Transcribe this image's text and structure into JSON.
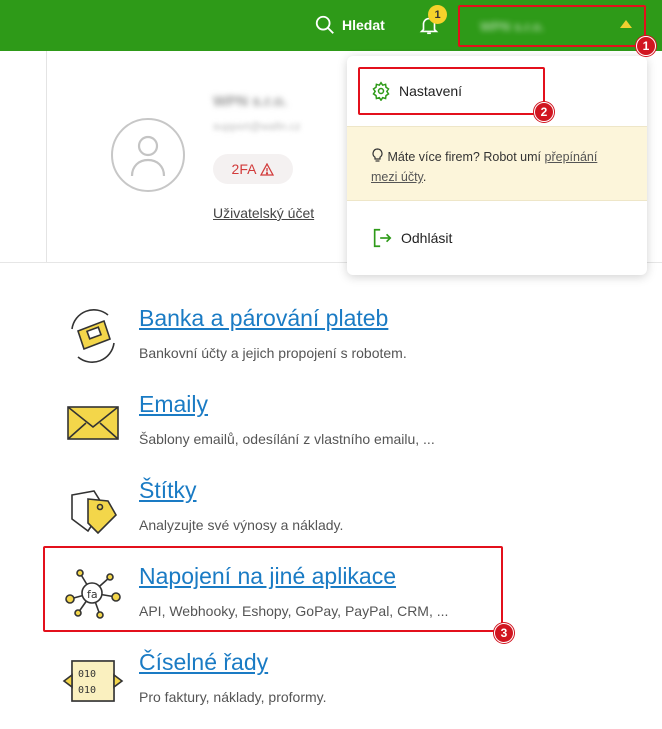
{
  "topbar": {
    "search_label": "Hledat",
    "notification_count": "1",
    "company_name": "WPN s.r.o."
  },
  "user": {
    "name": "WPN s.r.o.",
    "email": "support@wafin.cz",
    "twofa_label": "2FA",
    "account_link": "Uživatelský účet"
  },
  "dropdown": {
    "settings_label": "Nastavení",
    "tip_text": "Máte více firem? Robot umí ",
    "tip_link": "přepínání mezi účty",
    "tip_end": ".",
    "logout_label": "Odhlásit"
  },
  "items": [
    {
      "title": "Banka a párování plateb",
      "desc": "Bankovní účty a jejich propojení s robotem.",
      "icon": "bank-sync-icon"
    },
    {
      "title": "Emaily",
      "desc": "Šablony emailů, odesílání z vlastního emailu, ...",
      "icon": "envelope-icon"
    },
    {
      "title": "Štítky",
      "desc": "Analyzujte své výnosy a náklady.",
      "icon": "tag-icon"
    },
    {
      "title": "Napojení na jiné aplikace",
      "desc": "API, Webhooky, Eshopy, GoPay, PayPal, CRM, ...",
      "icon": "integrations-icon"
    },
    {
      "title": "Číselné řady",
      "desc": "Pro faktury, náklady, proformy.",
      "icon": "number-series-icon"
    }
  ],
  "annotations": [
    "1",
    "2",
    "3"
  ],
  "colors": {
    "topbar": "#2e9a18",
    "link": "#1a7bc4",
    "highlight": "#e3101c"
  }
}
